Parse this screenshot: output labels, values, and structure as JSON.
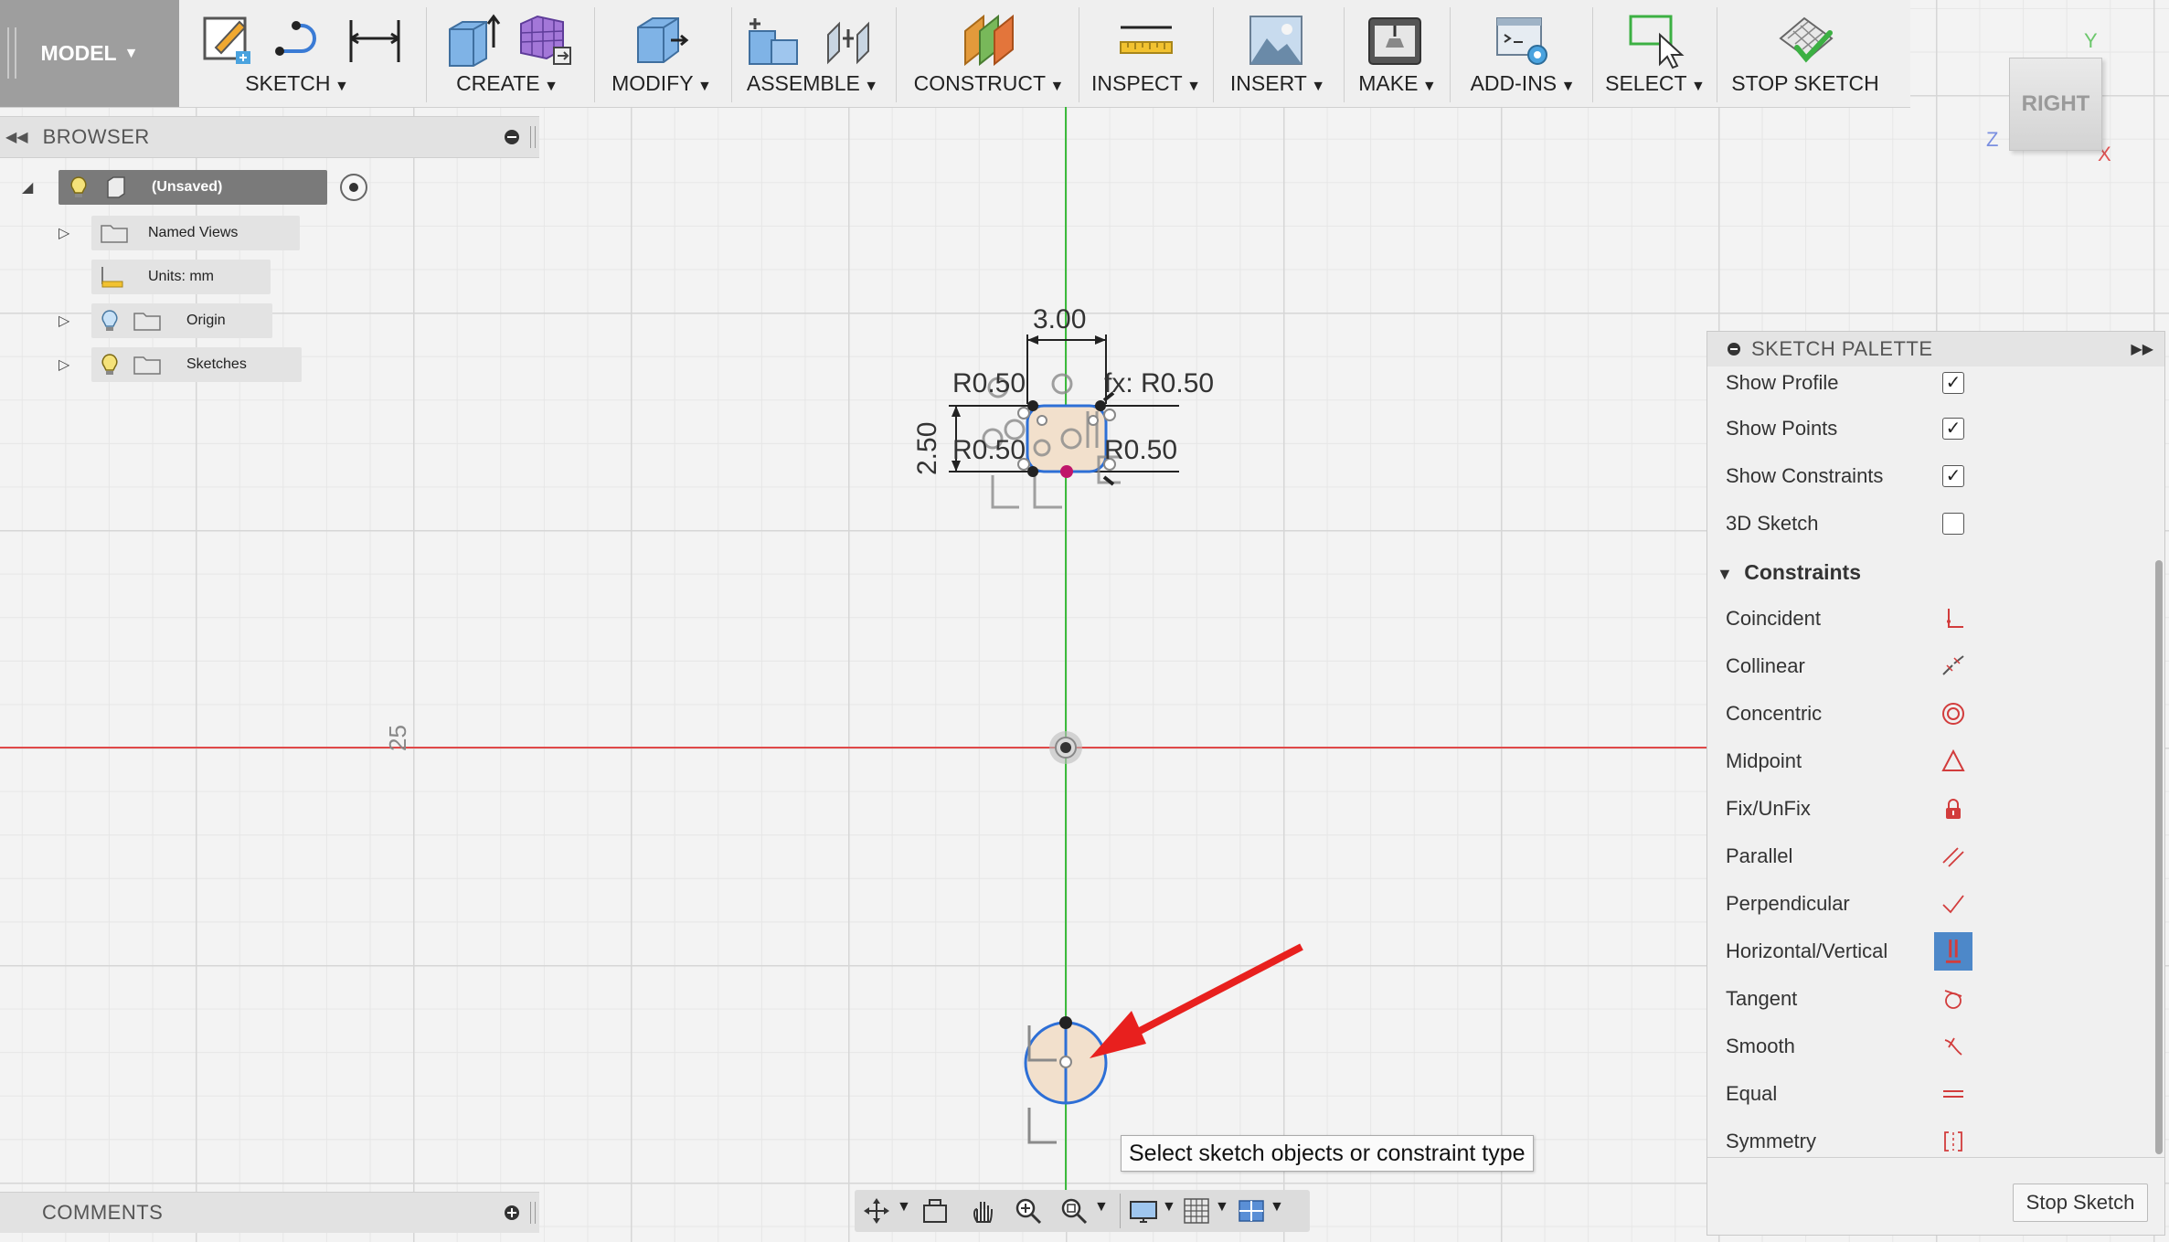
{
  "toolbar": {
    "model_label": "MODEL",
    "groups": {
      "sketch": "SKETCH",
      "create": "CREATE",
      "modify": "MODIFY",
      "assemble": "ASSEMBLE",
      "construct": "CONSTRUCT",
      "inspect": "INSPECT",
      "insert": "INSERT",
      "make": "MAKE",
      "addins": "ADD-INS",
      "select": "SELECT",
      "stop_sketch": "STOP SKETCH"
    }
  },
  "browser": {
    "title": "BROWSER",
    "items": [
      {
        "label": "(Unsaved)",
        "icon": "component-icon"
      },
      {
        "label": "Named Views",
        "icon": "folder-icon"
      },
      {
        "label": "Units: mm",
        "icon": "units-icon"
      },
      {
        "label": "Origin",
        "icon": "folder-icon"
      },
      {
        "label": "Sketches",
        "icon": "folder-icon"
      }
    ]
  },
  "viewport": {
    "dimensions": {
      "width": "3.00",
      "height": "2.50",
      "radius_tl": "R0.50",
      "radius_tr": "fx: R0.50",
      "radius_bl": "R0.50",
      "radius_br": "R0.50"
    },
    "grid_label": "25",
    "tooltip": "Select sketch objects or constraint type",
    "colors": {
      "y_axis": "#3cba3c",
      "x_axis": "#e04848",
      "arrow": "#e8201e"
    }
  },
  "viewcube": {
    "face": "RIGHT",
    "axis_y": "Y",
    "axis_z": "Z",
    "axis_x": "X"
  },
  "palette": {
    "title": "SKETCH PALETTE",
    "options": [
      {
        "label": "Show Profile",
        "checked": "✓"
      },
      {
        "label": "Show Points",
        "checked": "✓"
      },
      {
        "label": "Show Constraints",
        "checked": "✓"
      },
      {
        "label": "3D Sketch",
        "checked": ""
      }
    ],
    "constraints_title": "Constraints",
    "constraints": [
      {
        "label": "Coincident",
        "icon": "coincident-icon"
      },
      {
        "label": "Collinear",
        "icon": "collinear-icon"
      },
      {
        "label": "Concentric",
        "icon": "concentric-icon"
      },
      {
        "label": "Midpoint",
        "icon": "midpoint-icon"
      },
      {
        "label": "Fix/UnFix",
        "icon": "lock-icon"
      },
      {
        "label": "Parallel",
        "icon": "parallel-icon"
      },
      {
        "label": "Perpendicular",
        "icon": "perpendicular-icon"
      },
      {
        "label": "Horizontal/Vertical",
        "icon": "horizontal-vertical-icon"
      },
      {
        "label": "Tangent",
        "icon": "tangent-icon"
      },
      {
        "label": "Smooth",
        "icon": "smooth-icon"
      },
      {
        "label": "Equal",
        "icon": "equal-icon"
      },
      {
        "label": "Symmetry",
        "icon": "symmetry-icon"
      }
    ],
    "stop_button": "Stop Sketch"
  },
  "comments": {
    "title": "COMMENTS"
  }
}
